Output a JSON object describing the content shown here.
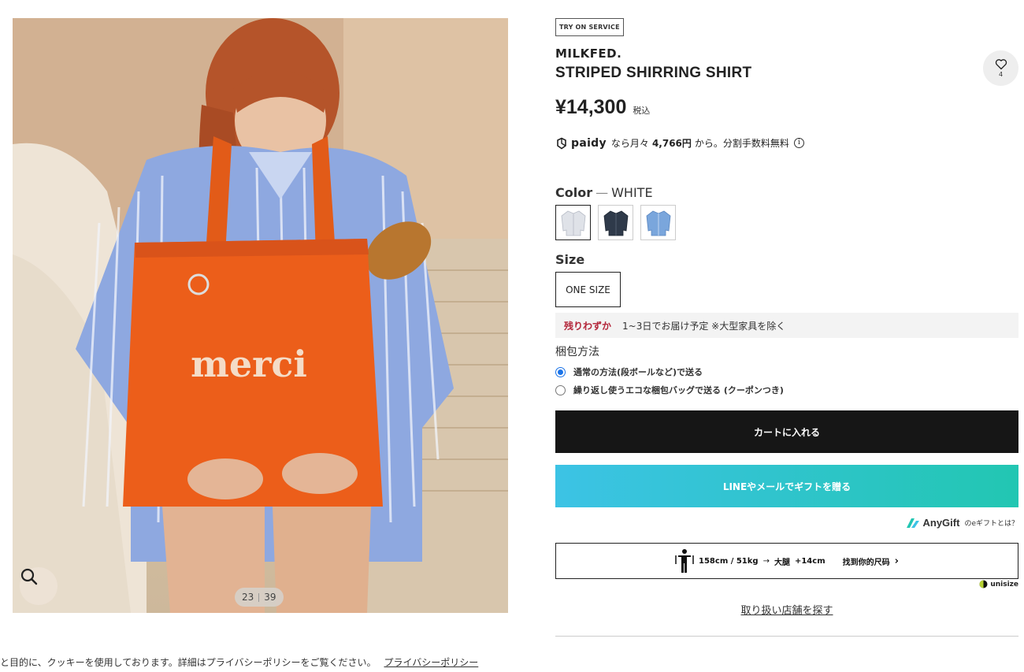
{
  "gallery": {
    "print_text": "merci",
    "current": "23",
    "total": "39",
    "zoom_icon": "search-icon"
  },
  "cookie": {
    "text": "と目的に、クッキーを使用しております。詳細はプライバシーポリシーをご覧ください。",
    "link": "プライバシーポリシー"
  },
  "product": {
    "badge": "TRY ON SERVICE",
    "brand": "MILKFED.",
    "title": "STRIPED SHIRRING SHIRT",
    "favorite_count": "4",
    "price": "¥14,300",
    "tax": "税込"
  },
  "paidy": {
    "logo": "paidy",
    "prefix": "なら月々",
    "amount": "4,766円",
    "suffix": "から。分割手数料無料"
  },
  "color": {
    "label": "Color",
    "dash": "—",
    "selected": "WHITE",
    "swatches": [
      {
        "name": "white",
        "color": "#dfe2e8"
      },
      {
        "name": "navy",
        "color": "#2f3a4a"
      },
      {
        "name": "blue",
        "color": "#7aa6dc"
      }
    ]
  },
  "size": {
    "label": "Size",
    "option": "ONE SIZE"
  },
  "stock": {
    "status": "残りわずか",
    "delivery": "1~3日でお届け予定 ※大型家具を除く"
  },
  "packaging": {
    "label": "梱包方法",
    "options": [
      "通常の方法(段ボールなど)で送る",
      "繰り返し使うエコな梱包バッグで送る (クーポンつき)"
    ]
  },
  "actions": {
    "cart": "カートに入れる",
    "gift": "LINEやメールでギフトを贈る"
  },
  "anygift": {
    "logo": "AnyGift",
    "help": "のeギフトとは？"
  },
  "fit": {
    "body": "158cm / 51kg",
    "arrow": "→",
    "part": "大腿",
    "diff": "+14cm",
    "cta": "找到你的尺码",
    "chevron": "›"
  },
  "unisize": "unisize",
  "store_link": "取り扱い店舗を探す",
  "colors": {
    "stock_alert": "#b3263a",
    "cart_bg": "#161616",
    "gift_gradient_start": "#3cc3e5",
    "gift_gradient_end": "#22c6b2",
    "radio_accent": "#1a73e8"
  }
}
